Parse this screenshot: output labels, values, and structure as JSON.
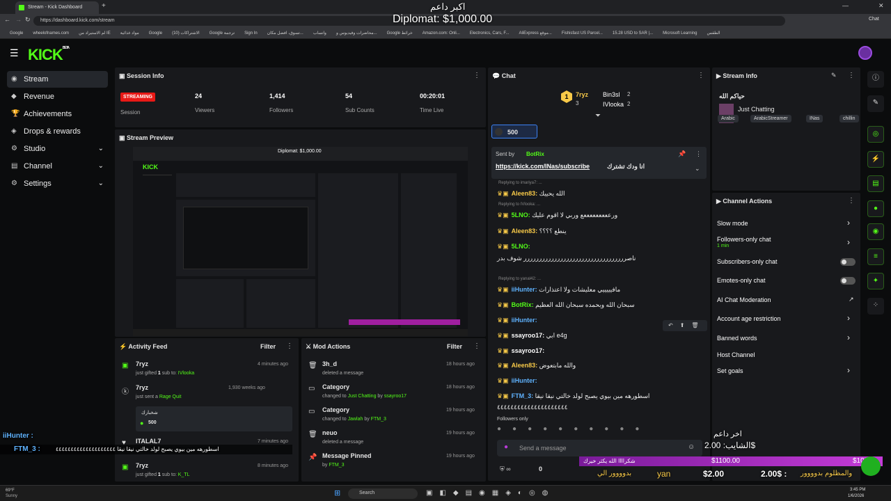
{
  "browser": {
    "tab_title": "Stream - Kick Dashboard",
    "url": "https://dashboard.kick.com/stream",
    "bookmarks": [
      "Google",
      "wheelofnames.com",
      "لم الاستيراد من IE",
      "مواد غذائية",
      "Google",
      "(10) الاشتراكات",
      "Google ترجمة",
      "Sign In",
      "تسوق، افضل مكان...",
      "واتساب",
      "محاضرات وفيديوس و...",
      "Google خرائط",
      "Amazon.com: Onli...",
      "Electronics, Cars, F...",
      "AliExpress موقع...",
      "Fishisfast US Parcel...",
      "15.28 USD to SAR |...",
      "Microsoft Learning",
      "الطقس"
    ],
    "profile_label": "Chat"
  },
  "overlay": {
    "donor_name_ar": "اكبر داعم",
    "donor_amount": "Diplomat: $1,000.00",
    "last_donor_ar": "اخر داعم",
    "last_donor_amount": "الشايب: 2.00$",
    "bar_left": "$1100.00",
    "bar_right": "$1000",
    "bottom_amount1": "$2.00",
    "bottom_amount2": "2.00$ :",
    "bottom_text": "yan",
    "bottom_ar1": "شكراااا الله يكثر خيرك",
    "bottom_ar2": "والمظلوم بدوووور",
    "bottom_ar3": "بدوووور الي",
    "chat_user1": "iiHunter :",
    "chat_user2": "FTM_3 :",
    "chat_msg2": "اسطورهه مين بيوي يصبح لولد خالتي نيقا نيقا ٤٤٤٤٤٤٤٤٤٤٤٤٤٤٤٤٤٤٤٤"
  },
  "nav": {
    "logo": "KICK",
    "logo_tag": "BETA",
    "items": [
      {
        "label": "Stream",
        "icon": "stream-icon"
      },
      {
        "label": "Revenue",
        "icon": "revenue-icon"
      },
      {
        "label": "Achievements",
        "icon": "trophy-icon"
      },
      {
        "label": "Drops & rewards",
        "icon": "drops-icon"
      },
      {
        "label": "Studio",
        "icon": "studio-icon"
      },
      {
        "label": "Channel",
        "icon": "channel-icon"
      },
      {
        "label": "Settings",
        "icon": "gear-icon"
      }
    ]
  },
  "session": {
    "title": "Session Info",
    "status": "STREAMING",
    "session_label": "Session",
    "viewers": "24",
    "viewers_label": "Viewers",
    "followers": "1,414",
    "followers_label": "Followers",
    "subs": "54",
    "subs_label": "Sub Counts",
    "time": "00:20:01",
    "time_label": "Time Live"
  },
  "preview": {
    "title": "Stream Preview"
  },
  "activity": {
    "title": "Activity Feed",
    "filter": "Filter",
    "items": [
      {
        "name": "7ryz",
        "text": "just gifted",
        "num": "1",
        "mid": "sub to:",
        "target": "IVlooka",
        "time": "4 minutes ago"
      },
      {
        "name": "7ryz",
        "text": "just sent a",
        "target": "Rage Quit",
        "time": "1,930 weeks ago",
        "box_ar": "شخبارك",
        "box_amount": "500"
      },
      {
        "name": "ITALAL7",
        "text": "",
        "time": "7 minutes ago"
      },
      {
        "name": "7ryz",
        "text": "just gifted",
        "num": "1",
        "mid": "sub to:",
        "target": "K_TL",
        "time": "8 minutes ago"
      }
    ]
  },
  "mod": {
    "title": "Mod Actions",
    "filter": "Filter",
    "items": [
      {
        "name": "3h_d",
        "text": "deleted a message",
        "time": "18 hours ago"
      },
      {
        "name": "Category",
        "text": "changed to",
        "target": "Just Chatting",
        "by": "by",
        "who": "ssayroo17",
        "time": "18 hours ago"
      },
      {
        "name": "Category",
        "text": "changed to",
        "target": "Jawlah",
        "by": "by",
        "who": "FTM_3",
        "time": "19 hours ago"
      },
      {
        "name": "neuo",
        "text": "deleted a message",
        "time": "19 hours ago"
      },
      {
        "name": "Message Pinned",
        "text": "by",
        "who": "FTM_3",
        "time": "19 hours ago"
      }
    ]
  },
  "chat": {
    "title": "Chat",
    "top1_name": "7ryz",
    "top1_count": "3",
    "top2_name": "Bin3sl",
    "top2_count": "2",
    "top3_name": "IVlooka",
    "top3_count": "2",
    "goal": "500",
    "pinned_by": "Sent by",
    "pinned_user": "BotRix",
    "pinned_link": "https://kick.com/INas/subscribe",
    "pinned_ar": "انا ودك تشترك",
    "lines": [
      {
        "reply": "Replying to imariya7: ...",
        "user": "Aleen83:",
        "msg": "الله يحييك",
        "color": "#f7c948"
      },
      {
        "reply": "Replying to IVlooka: ...",
        "user": "5LNO:",
        "msg": "ورعععععععععع وربي لا اقوم عليك",
        "color": "#53fc18"
      },
      {
        "reply": "",
        "user": "Aleen83:",
        "msg": "ينطع ؟؟؟؟",
        "color": "#f7c948"
      },
      {
        "reply": "",
        "user": "5LNO:",
        "msg": "",
        "color": "#53fc18"
      },
      {
        "reply": "",
        "user": "",
        "msg": "ناصرررررررررررررررررررررررررررررررررر شوف بدر",
        "color": "#fff"
      },
      {
        "reply": "Replying to yanal42: ...",
        "user": "iiHunter:",
        "msg": "مافيييييي معليشات ولا اعتذارات",
        "color": "#5fb3ff"
      },
      {
        "reply": "",
        "user": "BotRix:",
        "msg": "سبحان الله وبحمده سبحان الله العظيم",
        "color": "#53fc18"
      },
      {
        "reply": "",
        "user": "iiHunter:",
        "msg": "",
        "color": "#5fb3ff"
      },
      {
        "reply": "",
        "user": "ssayroo17:",
        "msg": "ابي e4g",
        "color": "#fff"
      },
      {
        "reply": "",
        "user": "ssayroo17:",
        "msg": "",
        "color": "#fff"
      },
      {
        "reply": "",
        "user": "Aleen83:",
        "msg": "والله مابتعوض",
        "color": "#f7c948"
      },
      {
        "reply": "",
        "user": "iiHunter:",
        "msg": "",
        "color": "#5fb3ff"
      },
      {
        "reply": "",
        "user": "FTM_3:",
        "msg": "اسطورهه مين بيوي يصبح لولد خالتي نيقا نيقا",
        "color": "#5fb3ff"
      },
      {
        "reply": "",
        "user": "",
        "msg": "٤٤٤٤٤٤٤٤٤٤٤٤٤٤٤٤٤٤٤٤٤",
        "color": "#fff"
      }
    ],
    "followers_only": "Followers only",
    "placeholder": "Send a message",
    "points": "0"
  },
  "stream_info": {
    "title": "Stream Info",
    "stream_title": "حياكم الله",
    "category": "Just Chatting",
    "tags": [
      "Arabic",
      "ArabicStreamer",
      "INas",
      "chillin"
    ]
  },
  "channel_actions": {
    "title": "Channel Actions",
    "slow_mode": "Slow mode",
    "followers_only": "Followers-only chat",
    "followers_sub": "1 min",
    "subs_only": "Subscribers-only chat",
    "emotes_only": "Emotes-only chat",
    "ai_mod": "AI Chat Moderation",
    "age": "Account age restriction",
    "banned": "Banned words",
    "host": "Host Channel",
    "goals": "Set goals"
  },
  "taskbar": {
    "temp": "69°F",
    "weather": "Sunny",
    "search": "Search",
    "time": "3:45 PM",
    "date": "1/6/2026"
  }
}
